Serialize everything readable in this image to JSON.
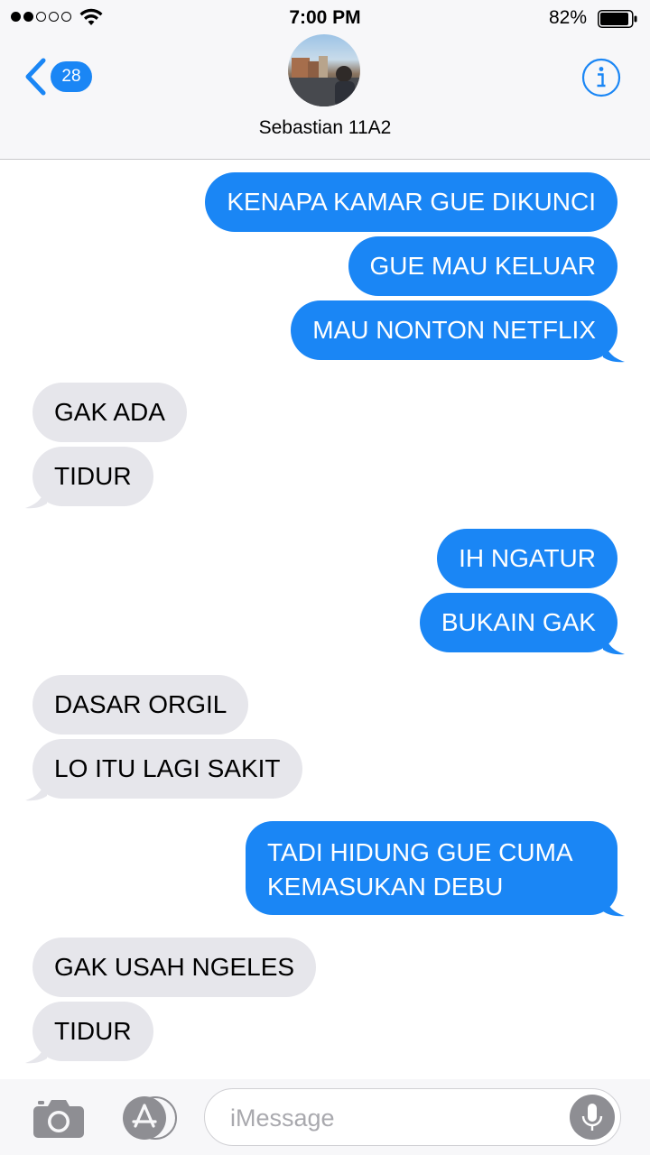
{
  "status_bar": {
    "time": "7:00 PM",
    "battery_percent": "82%",
    "battery_level": 0.82,
    "signal_filled": 2,
    "signal_total": 5
  },
  "header": {
    "back_count": "28",
    "contact_name": "Sebastian 11A2"
  },
  "messages": [
    {
      "from": "me",
      "text": "KENAPA KAMAR GUE DIKUNCI"
    },
    {
      "from": "me",
      "text": "GUE MAU KELUAR"
    },
    {
      "from": "me",
      "text": "MAU NONTON NETFLIX"
    },
    {
      "from": "them",
      "text": "GAK ADA"
    },
    {
      "from": "them",
      "text": "TIDUR"
    },
    {
      "from": "me",
      "text": "IH NGATUR"
    },
    {
      "from": "me",
      "text": "BUKAIN GAK"
    },
    {
      "from": "them",
      "text": "DASAR ORGIL"
    },
    {
      "from": "them",
      "text": "LO ITU LAGI SAKIT"
    },
    {
      "from": "me",
      "text": "TADI HIDUNG GUE CUMA KEMASUKAN DEBU"
    },
    {
      "from": "them",
      "text": "GAK USAH NGELES"
    },
    {
      "from": "them",
      "text": "TIDUR"
    }
  ],
  "input_bar": {
    "placeholder": "iMessage"
  },
  "colors": {
    "outgoing": "#1a86f5",
    "incoming": "#e6e6eb",
    "accent": "#1a86f5"
  },
  "icons": [
    "wifi-icon",
    "battery-icon",
    "back-chevron-icon",
    "info-icon",
    "camera-icon",
    "app-store-icon",
    "microphone-icon"
  ]
}
